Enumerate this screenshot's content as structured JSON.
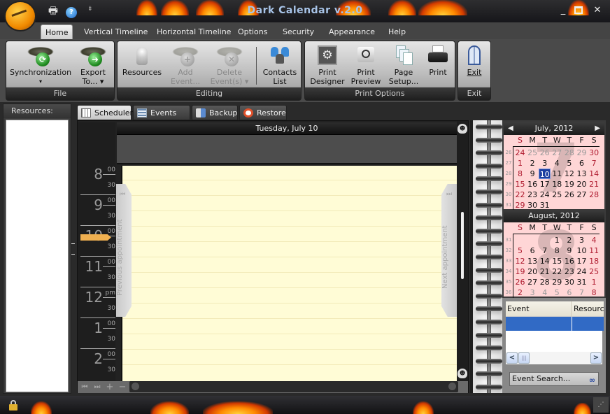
{
  "window": {
    "title": "Dark Calendar v.2.0",
    "controls": {
      "minimize": "_",
      "maximize": "□",
      "close": "✕"
    }
  },
  "quick_access": {
    "print_icon": "printer-icon",
    "help_icon": "help-icon",
    "help_glyph": "?",
    "customize_glyph": "⇟"
  },
  "ribbon": {
    "tabs": [
      {
        "label": "Home",
        "active": true
      },
      {
        "label": "Vertical Timeline"
      },
      {
        "label": "Horizontal Timeline"
      },
      {
        "label": "Options"
      },
      {
        "label": "Security"
      },
      {
        "label": "Appearance"
      },
      {
        "label": "Help"
      }
    ],
    "groups": {
      "file": {
        "label": "File",
        "buttons": [
          {
            "label": "Synchronization",
            "line2": "▾",
            "icon": "sync-icon",
            "glyph": "⟳"
          },
          {
            "label": "Export",
            "line2": "To...  ▾",
            "icon": "export-icon",
            "glyph": "➜"
          }
        ]
      },
      "editing": {
        "label": "Editing",
        "buttons": [
          {
            "label": "Resources",
            "line2": "",
            "icon": "resources-icon",
            "enabled": true
          },
          {
            "label": "Add",
            "line2": "Event...",
            "icon": "add-event-icon",
            "glyph": "+",
            "enabled": false
          },
          {
            "label": "Delete",
            "line2": "Event(s) ▾",
            "icon": "delete-event-icon",
            "glyph": "✕",
            "enabled": false
          },
          {
            "label": "Contacts",
            "line2": "List",
            "icon": "contacts-icon",
            "enabled": true
          }
        ]
      },
      "print_options": {
        "label": "Print Options",
        "buttons": [
          {
            "label": "Print",
            "line2": "Designer",
            "icon": "print-designer-icon",
            "glyph": "⚙"
          },
          {
            "label": "Print",
            "line2": "Preview",
            "icon": "print-preview-icon",
            "glyph": "🔍"
          },
          {
            "label": "Page",
            "line2": "Setup...",
            "icon": "page-setup-icon"
          },
          {
            "label": "Print",
            "line2": "",
            "icon": "printer-icon"
          }
        ]
      },
      "exit": {
        "label": "Exit",
        "buttons": [
          {
            "label": "Exit",
            "line2": "",
            "icon": "exit-door-icon"
          }
        ]
      }
    }
  },
  "resources_panel": {
    "header": "Resources:"
  },
  "view_tabs": [
    {
      "label": "Scheduler",
      "icon": "calendar-grid-icon",
      "active": true
    },
    {
      "label": "Events List",
      "icon": "list-icon"
    },
    {
      "label": "Backup",
      "icon": "backup-icon"
    },
    {
      "label": "Restore",
      "icon": "lifebuoy-icon"
    }
  ],
  "scheduler": {
    "date_header": "Tuesday, July 10",
    "hours": [
      {
        "h": "8",
        "sub": "00"
      },
      {
        "h": "9",
        "sub": "00"
      },
      {
        "h": "10",
        "sub": "00"
      },
      {
        "h": "11",
        "sub": "00"
      },
      {
        "h": "12",
        "sub": "pm"
      },
      {
        "h": "1",
        "sub": "00"
      },
      {
        "h": "2",
        "sub": "00"
      }
    ],
    "half_label": "30",
    "current_time_hour": "10",
    "prev_appointment": "Previous appointment",
    "next_appointment": "Next appointment",
    "skip_prev_glyph": "⏮",
    "skip_next_glyph": "⏭",
    "bottom_buttons": {
      "first": "⏮",
      "last": "⏭",
      "add": "+",
      "remove": "−"
    }
  },
  "mini_calendars": [
    {
      "month": "July, 2012",
      "big_number": "7",
      "nav_prev": "◀",
      "nav_next": "▶",
      "dow": [
        "S",
        "M",
        "T",
        "W",
        "T",
        "F",
        "S"
      ],
      "weeks": [
        {
          "wk": "26",
          "days": [
            [
              "24",
              "c"
            ],
            [
              "25",
              "o"
            ],
            [
              "26",
              "o"
            ],
            [
              "27",
              "o"
            ],
            [
              "28",
              "o"
            ],
            [
              "29",
              "o"
            ],
            [
              "30",
              "w"
            ]
          ]
        },
        {
          "wk": "27",
          "days": [
            [
              "1",
              "w"
            ],
            [
              "2",
              ""
            ],
            [
              "3",
              ""
            ],
            [
              "4",
              ""
            ],
            [
              "5",
              ""
            ],
            [
              "6",
              ""
            ],
            [
              "7",
              "w"
            ]
          ]
        },
        {
          "wk": "28",
          "days": [
            [
              "8",
              "w"
            ],
            [
              "9",
              ""
            ],
            [
              "10",
              "sel"
            ],
            [
              "11",
              ""
            ],
            [
              "12",
              ""
            ],
            [
              "13",
              ""
            ],
            [
              "14",
              "w"
            ]
          ]
        },
        {
          "wk": "29",
          "days": [
            [
              "15",
              "w"
            ],
            [
              "16",
              ""
            ],
            [
              "17",
              ""
            ],
            [
              "18",
              ""
            ],
            [
              "19",
              ""
            ],
            [
              "20",
              ""
            ],
            [
              "21",
              "w"
            ]
          ]
        },
        {
          "wk": "30",
          "days": [
            [
              "22",
              "w"
            ],
            [
              "23",
              ""
            ],
            [
              "24",
              ""
            ],
            [
              "25",
              ""
            ],
            [
              "26",
              ""
            ],
            [
              "27",
              ""
            ],
            [
              "28",
              "w"
            ]
          ]
        },
        {
          "wk": "31",
          "days": [
            [
              "29",
              "w"
            ],
            [
              "30",
              ""
            ],
            [
              "31",
              ""
            ],
            [
              "",
              ""
            ],
            [
              "",
              ""
            ],
            [
              "",
              ""
            ],
            [
              "",
              ""
            ]
          ]
        }
      ]
    },
    {
      "month": "August, 2012",
      "big_number": "8",
      "dow": [
        "S",
        "M",
        "T",
        "W",
        "T",
        "F",
        "S"
      ],
      "weeks": [
        {
          "wk": "31",
          "days": [
            [
              "",
              ""
            ],
            [
              "",
              ""
            ],
            [
              "",
              ""
            ],
            [
              "1",
              ""
            ],
            [
              "2",
              ""
            ],
            [
              "3",
              ""
            ],
            [
              "4",
              "w"
            ]
          ]
        },
        {
          "wk": "32",
          "days": [
            [
              "5",
              "w"
            ],
            [
              "6",
              ""
            ],
            [
              "7",
              ""
            ],
            [
              "8",
              ""
            ],
            [
              "9",
              ""
            ],
            [
              "10",
              ""
            ],
            [
              "11",
              "w"
            ]
          ]
        },
        {
          "wk": "33",
          "days": [
            [
              "12",
              "w"
            ],
            [
              "13",
              ""
            ],
            [
              "14",
              ""
            ],
            [
              "15",
              ""
            ],
            [
              "16",
              ""
            ],
            [
              "17",
              ""
            ],
            [
              "18",
              "w"
            ]
          ]
        },
        {
          "wk": "34",
          "days": [
            [
              "19",
              "w"
            ],
            [
              "20",
              ""
            ],
            [
              "21",
              ""
            ],
            [
              "22",
              ""
            ],
            [
              "23",
              ""
            ],
            [
              "24",
              ""
            ],
            [
              "25",
              "w"
            ]
          ]
        },
        {
          "wk": "35",
          "days": [
            [
              "26",
              "w"
            ],
            [
              "27",
              ""
            ],
            [
              "28",
              ""
            ],
            [
              "29",
              ""
            ],
            [
              "30",
              ""
            ],
            [
              "31",
              ""
            ],
            [
              "1",
              "w"
            ]
          ]
        },
        {
          "wk": "36",
          "days": [
            [
              "2",
              "w"
            ],
            [
              "3",
              "o"
            ],
            [
              "4",
              "o"
            ],
            [
              "5",
              "o"
            ],
            [
              "6",
              "o"
            ],
            [
              "7",
              "o"
            ],
            [
              "8",
              "w"
            ]
          ]
        }
      ]
    }
  ],
  "events_grid": {
    "columns": [
      "Event",
      "Resource"
    ],
    "scroll_left": "<",
    "scroll_right": ">",
    "thumb_glyph": "|||"
  },
  "event_search": {
    "label": "Event Search...",
    "icon": "binoculars-icon",
    "glyph": "👓"
  },
  "colors": {
    "accent_selected": "#1c3ea0",
    "grid_selected_row": "#316ac5",
    "day_background": "#fffcd6",
    "calendar_background": "#ffd6d6",
    "weekend_text": "#b01c30",
    "now_marker": "#f0b050",
    "title_text": "#a8c4e8"
  }
}
